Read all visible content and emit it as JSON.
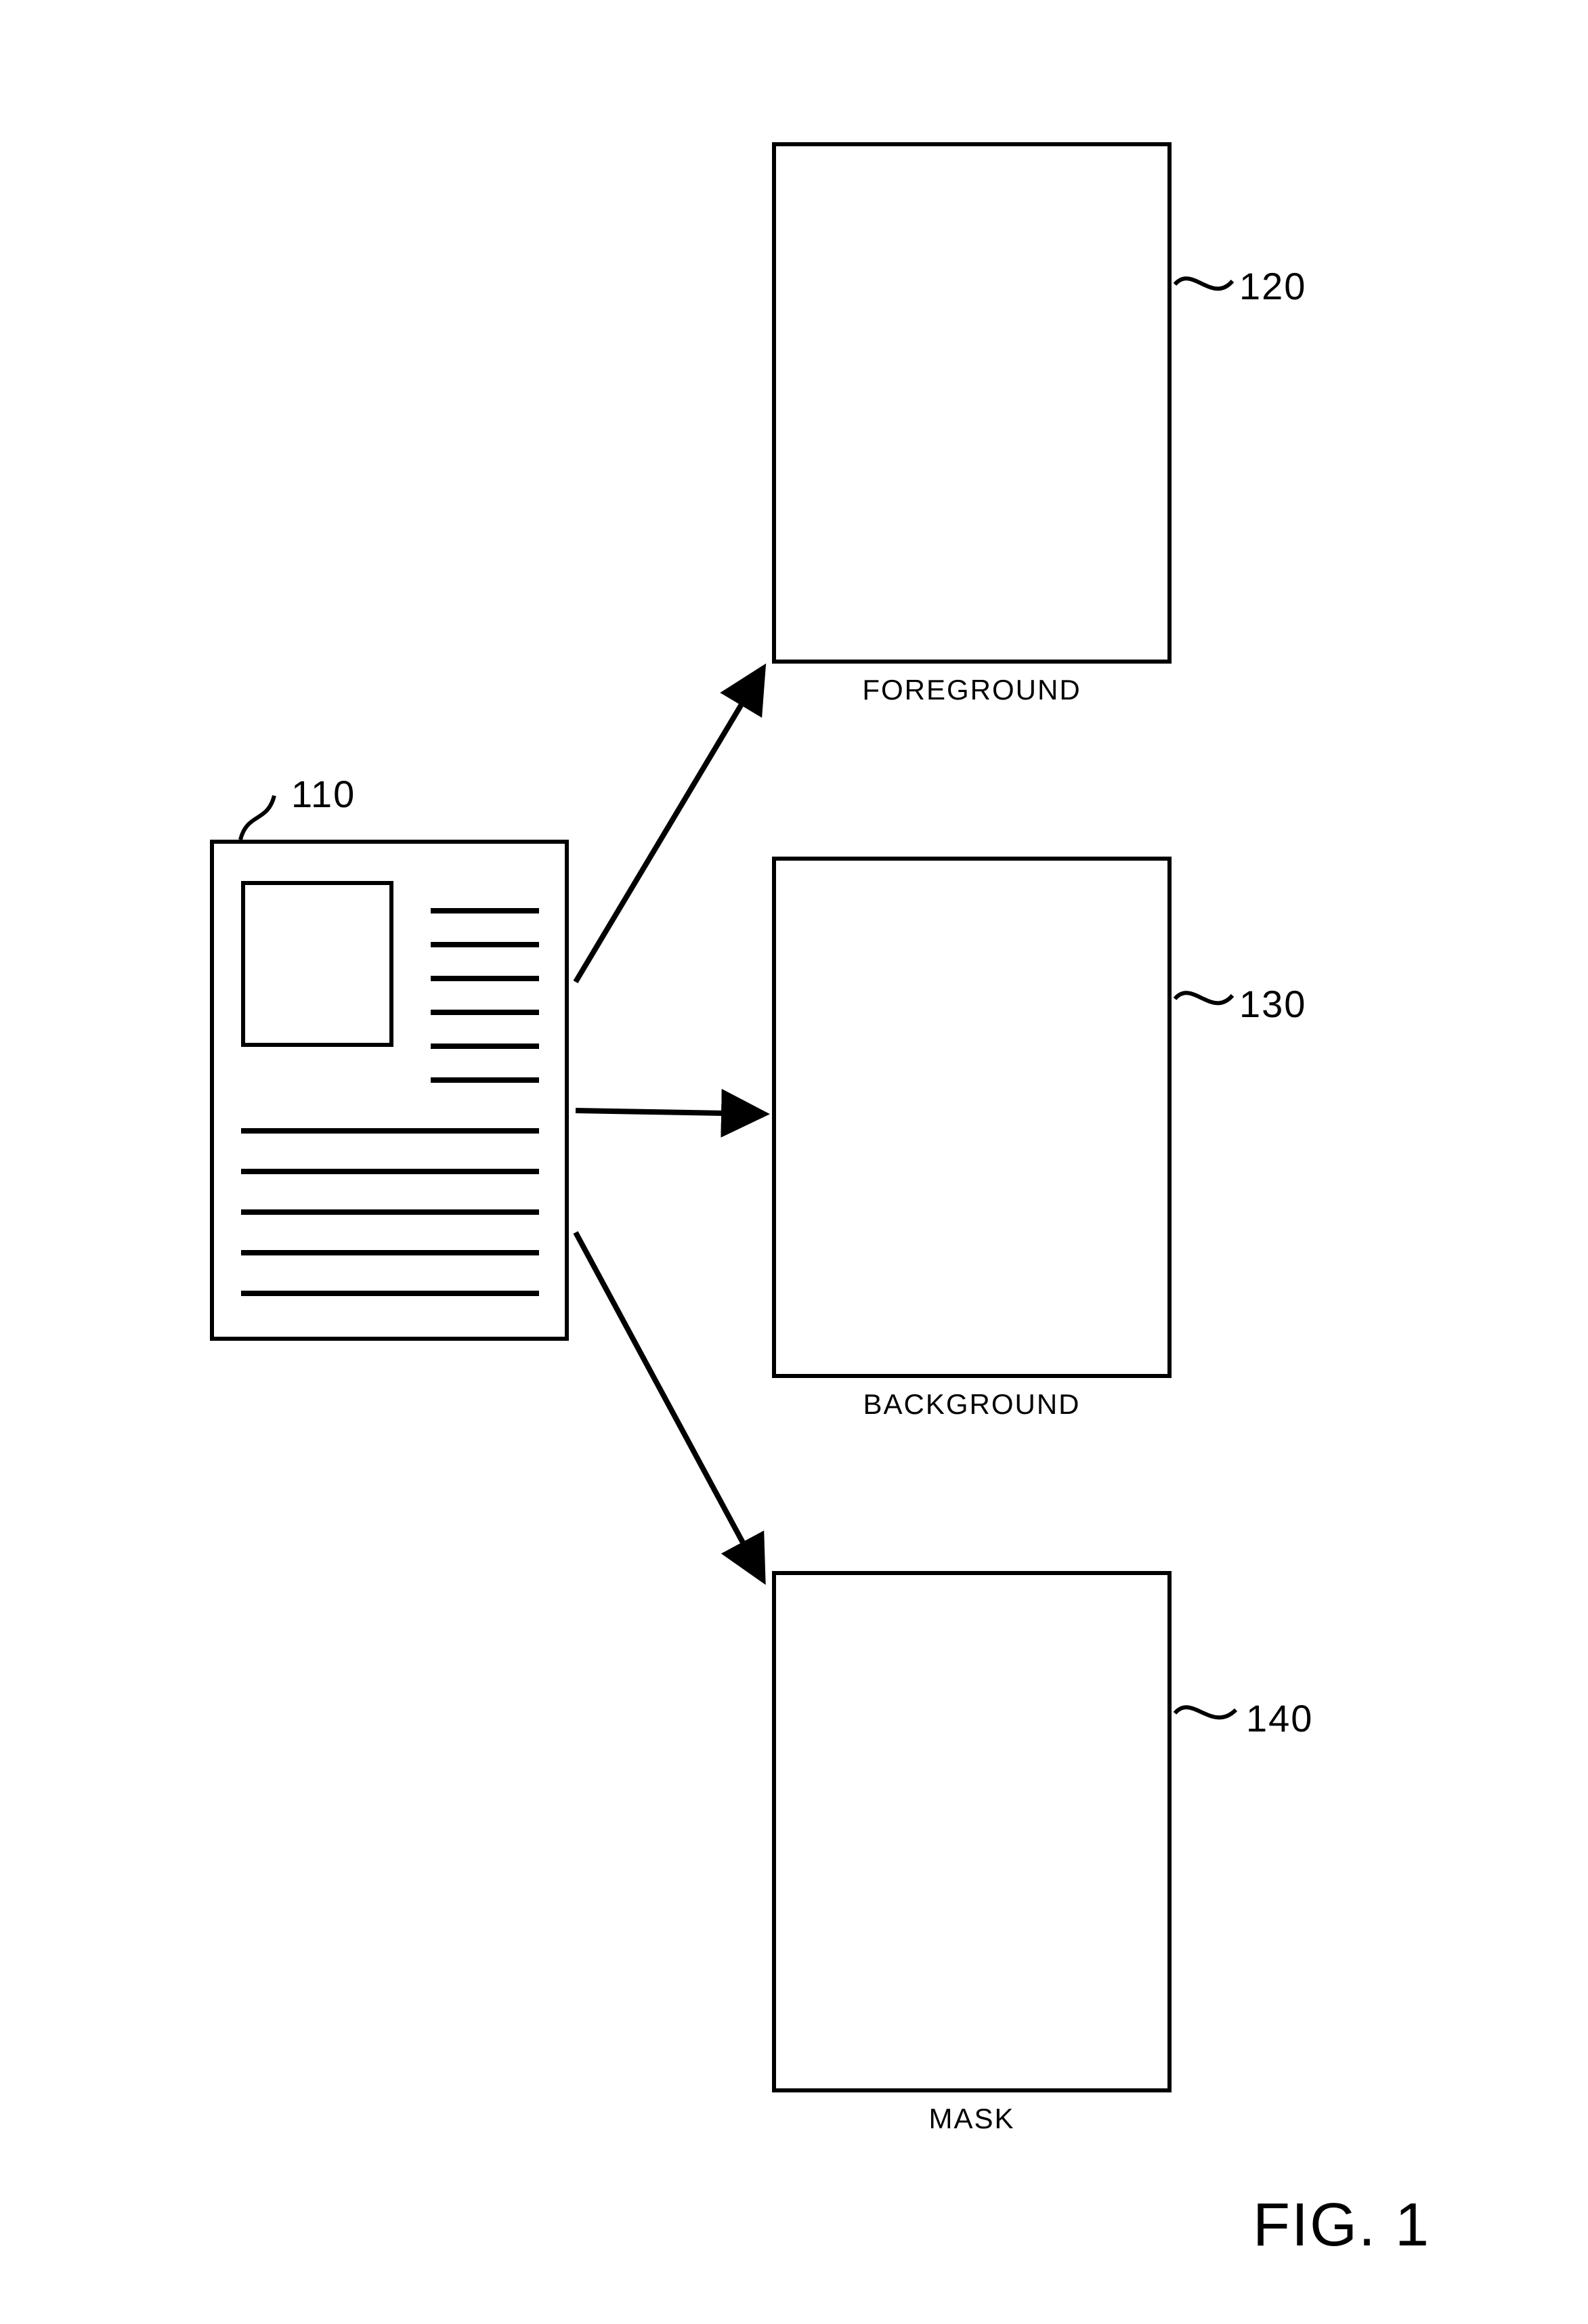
{
  "figure": {
    "title": "FIG. 1",
    "source": {
      "ref": "110"
    },
    "outputs": {
      "foreground": {
        "label": "FOREGROUND",
        "ref": "120"
      },
      "background": {
        "label": "BACKGROUND",
        "ref": "130"
      },
      "mask": {
        "label": "MASK",
        "ref": "140"
      }
    }
  }
}
